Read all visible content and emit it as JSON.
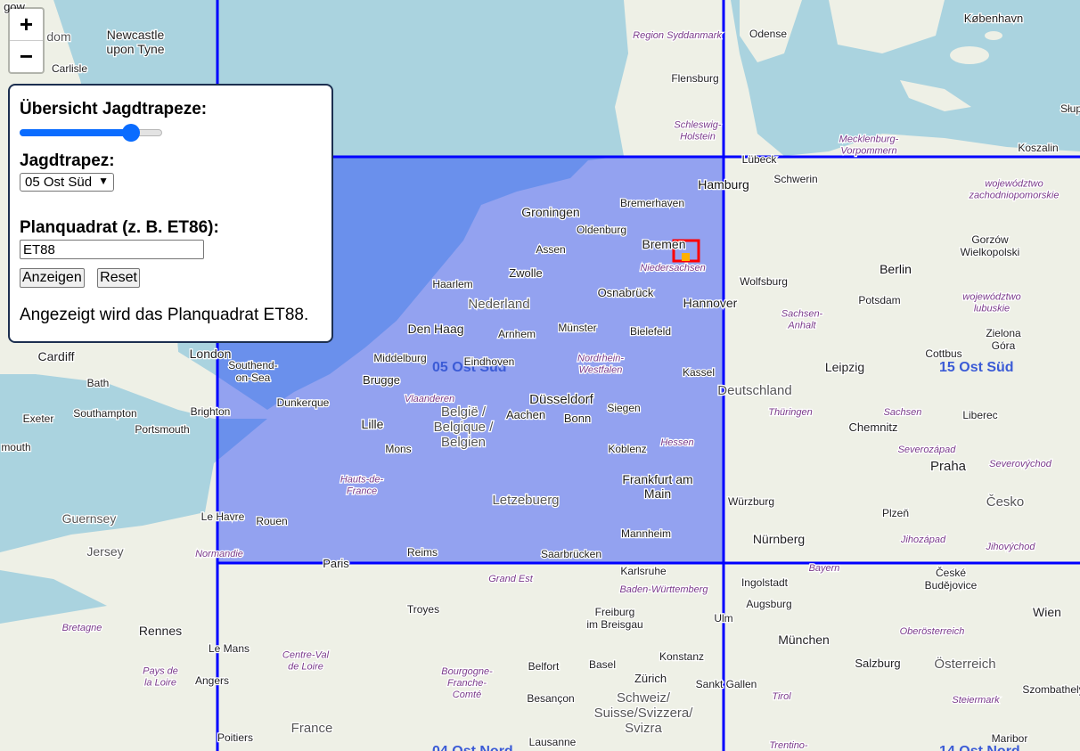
{
  "colors": {
    "sea": "#aad3df",
    "land": "#eef0e6",
    "grid_line": "#0000ff",
    "selected_fill": "#0a2cff",
    "marker": "#ff0000",
    "accent": "#0a6cff"
  },
  "panel": {
    "overview_label": "Übersicht Jagdtrapeze:",
    "opacity_value": 0.78,
    "trapez_label": "Jagdtrapez:",
    "trapez_selected": "05 Ost Süd",
    "planquadrat_label": "Planquadrat (z. B. ET86):",
    "planquadrat_value": "ET88",
    "show_button": "Anzeigen",
    "reset_button": "Reset",
    "status_text": "Angezeigt wird das Planquadrat ET88."
  },
  "zoom": {
    "in": "+",
    "out": "−"
  },
  "trapez_labels": [
    {
      "id": "05",
      "text": "05 Ost Süd"
    },
    {
      "id": "15",
      "text": "15 Ost Süd"
    },
    {
      "id": "04",
      "text": "04 Ost Nord"
    },
    {
      "id": "14",
      "text": "14 Ost Nord"
    }
  ],
  "places": [
    "København",
    "Odense",
    "Region Syddanmark",
    "Flensburg",
    "Schleswig-Holstein",
    "Lübeck",
    "Hamburg",
    "Schwerin",
    "Mecklenburg-Vorpommern",
    "Koszalin",
    "województwo zachodniopomorskie",
    "Groningen",
    "Bremerhaven",
    "Oldenburg",
    "Bremen",
    "Niedersachsen",
    "Assen",
    "Zwolle",
    "Haarlem",
    "Nederland",
    "Osnabrück",
    "Hannover",
    "Wolfsburg",
    "Berlin",
    "Gorzów Wielkopolski",
    "Potsdam",
    "województwo lubuskie",
    "Den Haag",
    "Arnhem",
    "Münster",
    "Bielefeld",
    "Sachsen-Anhalt",
    "Middelburg",
    "Kassel",
    "Nordrhein-Westfalen",
    "Eindhoven",
    "Brugge",
    "Düsseldorf",
    "Deutschland",
    "Leipzig",
    "Cottbus",
    "Zielona Góra",
    "Dunkerque",
    "Vlaanderen",
    "Aachen",
    "Bonn",
    "Siegen",
    "Thüringen",
    "Sachsen",
    "Liberec",
    "Lille",
    "België / Belgique / Belgien",
    "Mons",
    "Koblenz",
    "Hessen",
    "Chemnitz",
    "Severozápad",
    "Praha",
    "Severovýchod",
    "Hauts-de-France",
    "Letzebuerg",
    "Frankfurt am Main",
    "Würzburg",
    "Plzeň",
    "Česko",
    "Le Havre",
    "Rouen",
    "Mannheim",
    "Nürnberg",
    "Jihozápad",
    "Jihovýchod",
    "Normandie",
    "Reims",
    "Saarbrücken",
    "Paris",
    "Karlsruhe",
    "Grand Est",
    "Baden-Württemberg",
    "Bayern",
    "Ingolstadt",
    "České Budějovice",
    "Troyes",
    "Freiburg im Breisgau",
    "Augsburg",
    "Ulm",
    "Wien",
    "Bretagne",
    "Rennes",
    "Le Mans",
    "München",
    "Oberösterreich",
    "Centre-Val de Loire",
    "Konstanz",
    "Basel",
    "Belfort",
    "Salzburg",
    "Österreich",
    "Pays de la Loire",
    "Angers",
    "Zürich",
    "Sankt Gallen",
    "Tirol",
    "Steiermark",
    "Szombathely",
    "Bourgogne-Franche-Comté",
    "Besançon",
    "Schweiz/ Suisse/Svizzera/ Svizra",
    "France",
    "Lausanne",
    "Poitiers",
    "Trentino-",
    "Maribor",
    "Newcastle upon Tyne",
    "Carlisle",
    "Cardiff",
    "London",
    "Bath",
    "Southend-on-Sea",
    "Exeter",
    "Southampton",
    "Brighton",
    "Portsmouth",
    "Guernsey",
    "Jersey",
    "gow",
    "dom",
    "mouth",
    "Słup"
  ]
}
